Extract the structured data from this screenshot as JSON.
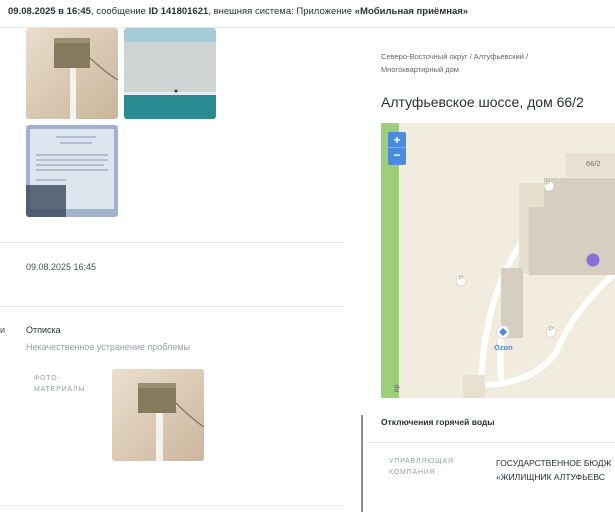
{
  "header": {
    "datetime": "09.08.2025 в 16:45",
    "msg_prefix": ", сообщение ",
    "msg_id": "ID 141801621",
    "system_prefix": ", внешняя система: Приложение ",
    "system_name": "«Мобильная приёмная»"
  },
  "left": {
    "date_value": "09.08.2025 16:45",
    "cut_label": "и",
    "status_title": "Отписка",
    "status_reason": "Некачественное устранение проблемы",
    "photo_label_line1": "ФОТО-",
    "photo_label_line2": "МАТЕРИАЛЫ"
  },
  "right": {
    "breadcrumb_line1": "Северо-Восточный округ / Алтуфьевский /",
    "breadcrumb_line2": "Многоквартирный дом",
    "address": "Алтуфьевское шоссе, дом 66/2",
    "map": {
      "zoom_in": "+",
      "zoom_out": "−",
      "building_label": "66/2",
      "poi_ozon": "Ozon",
      "parking_label": "P",
      "vertical_text": "ер"
    },
    "section_title": "Отключения горячей воды",
    "company_label_line1": "УПРАВЛЯЮЩАЯ",
    "company_label_line2": "КОМПАНИЯ",
    "company_value_line1": "ГОСУДАРСТВЕННОЕ БЮДЖ",
    "company_value_line2": "«ЖИЛИЩНИК АЛТУФЬЕВС"
  },
  "colors": {
    "accent_blue": "#4a8be0",
    "marker_purple": "#8a6fd6",
    "map_bg": "#f2ecdf",
    "building": "#d9d2c4",
    "green_strip": "#9fce7a"
  }
}
